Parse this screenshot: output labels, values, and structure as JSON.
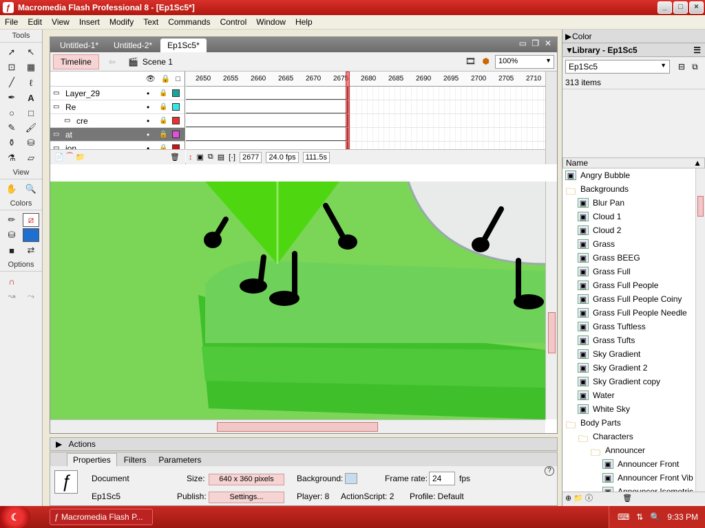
{
  "window": {
    "title": "Macromedia Flash Professional 8 - [Ep1Sc5*]",
    "app_icon": "flash-icon"
  },
  "menu": [
    "File",
    "Edit",
    "View",
    "Insert",
    "Modify",
    "Text",
    "Commands",
    "Control",
    "Window",
    "Help"
  ],
  "tools": {
    "header": "Tools",
    "view_label": "View",
    "colors_label": "Colors",
    "options_label": "Options"
  },
  "document": {
    "tabs": [
      "Untitled-1*",
      "Untitled-2*",
      "Ep1Sc5*"
    ],
    "timeline_label": "Timeline",
    "scene": "Scene 1",
    "zoom": "100%"
  },
  "timeline": {
    "ruler": [
      "2650",
      "2655",
      "2660",
      "2665",
      "2670",
      "2675",
      "2680",
      "2685",
      "2690",
      "2695",
      "2700",
      "2705",
      "2710"
    ],
    "layers": [
      {
        "name": "Layer_29",
        "color": "#1aa39a",
        "selected": false
      },
      {
        "name": "Re",
        "color": "#33e5e5",
        "selected": false
      },
      {
        "name": "cre",
        "color": "#e83030",
        "selected": false
      },
      {
        "name": "at",
        "color": "#e050e0",
        "selected": true
      },
      {
        "name": "ion",
        "color": "#d01010",
        "selected": false
      }
    ],
    "current_frame": "2677",
    "fps": "24.0 fps",
    "elapsed": "111.5s"
  },
  "actions_label": "Actions",
  "properties": {
    "tabs": [
      "Properties",
      "Filters",
      "Parameters"
    ],
    "type": "Document",
    "name": "Ep1Sc5",
    "size_label": "Size:",
    "size_value": "640 x 360 pixels",
    "background_label": "Background:",
    "background_color": "#c8dcf0",
    "frame_rate_label": "Frame rate:",
    "frame_rate_value": "24",
    "fps_unit": "fps",
    "publish_label": "Publish:",
    "settings_button": "Settings...",
    "player": "Player: 8",
    "actionscript": "ActionScript: 2",
    "profile": "Profile: Default"
  },
  "right": {
    "color_panel": "Color",
    "library_panel": "Library - Ep1Sc5",
    "library_select": "Ep1Sc5",
    "item_count": "313 items",
    "name_header": "Name",
    "items": [
      {
        "label": "Angry Bubble",
        "folder": false,
        "indent": 0
      },
      {
        "label": "Backgrounds",
        "folder": true,
        "indent": 0
      },
      {
        "label": "Blur Pan",
        "folder": false,
        "indent": 1
      },
      {
        "label": "Cloud 1",
        "folder": false,
        "indent": 1
      },
      {
        "label": "Cloud 2",
        "folder": false,
        "indent": 1
      },
      {
        "label": "Grass",
        "folder": false,
        "indent": 1
      },
      {
        "label": "Grass BEEG",
        "folder": false,
        "indent": 1
      },
      {
        "label": "Grass Full",
        "folder": false,
        "indent": 1
      },
      {
        "label": "Grass Full People",
        "folder": false,
        "indent": 1
      },
      {
        "label": "Grass Full People Coiny",
        "folder": false,
        "indent": 1
      },
      {
        "label": "Grass Full People Needle",
        "folder": false,
        "indent": 1
      },
      {
        "label": "Grass Tuftless",
        "folder": false,
        "indent": 1
      },
      {
        "label": "Grass Tufts",
        "folder": false,
        "indent": 1
      },
      {
        "label": "Sky Gradient",
        "folder": false,
        "indent": 1
      },
      {
        "label": "Sky Gradient 2",
        "folder": false,
        "indent": 1
      },
      {
        "label": "Sky Gradient copy",
        "folder": false,
        "indent": 1
      },
      {
        "label": "Water",
        "folder": false,
        "indent": 1
      },
      {
        "label": "White Sky",
        "folder": false,
        "indent": 1
      },
      {
        "label": "Body Parts",
        "folder": true,
        "indent": 0
      },
      {
        "label": "Characters",
        "folder": true,
        "indent": 1
      },
      {
        "label": "Announcer",
        "folder": true,
        "indent": 2
      },
      {
        "label": "Announcer Front",
        "folder": false,
        "indent": 3
      },
      {
        "label": "Announcer Front Vib",
        "folder": false,
        "indent": 3
      },
      {
        "label": "Announcer Isometric",
        "folder": false,
        "indent": 3
      }
    ]
  },
  "taskbar": {
    "task": "Macromedia Flash P...",
    "clock": "9:33 PM"
  }
}
